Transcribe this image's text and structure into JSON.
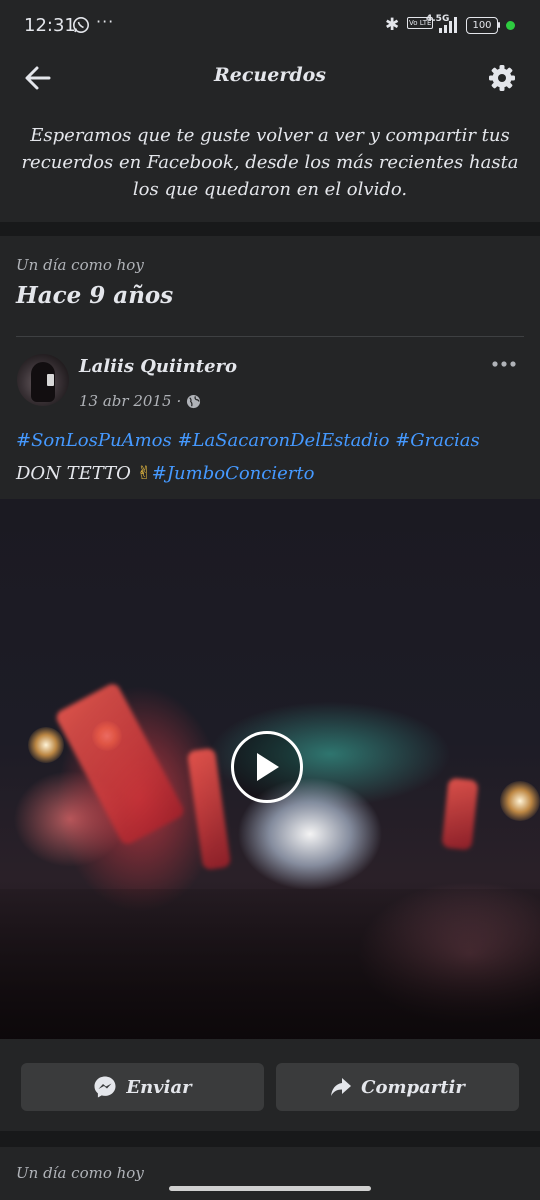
{
  "status_bar": {
    "time": "12:31",
    "more": "···",
    "volte": "Vo LTE",
    "network": "4.5G",
    "battery": "100"
  },
  "header": {
    "title": "Recuerdos",
    "intro": "Esperamos que te guste volver a ver y compartir tus recuerdos en Facebook, desde los más recientes hasta los que quedaron en el olvido."
  },
  "memory": {
    "subtitle": "Un día como hoy",
    "years_ago": "Hace 9 años",
    "post": {
      "author": "Laliis Quiintero",
      "date": "13 abr 2015",
      "date_separator": "·",
      "hashtags_line1": [
        "#SonLosPuAmos",
        "#LaSacaronDelEstadio",
        "#Gracias"
      ],
      "text_line2": "DON TETTO",
      "emoji": "✌",
      "hashtag_line2": "#JumboConcierto"
    },
    "actions": {
      "send": "Enviar",
      "share": "Compartir"
    }
  },
  "next_memory": {
    "subtitle": "Un día como hoy"
  },
  "icons": {
    "back": "arrow-left-icon",
    "settings": "gear-icon",
    "more": "more-horizontal-icon",
    "privacy": "globe-icon",
    "play": "play-icon",
    "send": "messenger-icon",
    "share": "share-arrow-icon"
  },
  "colors": {
    "background": "#18191a",
    "surface": "#242526",
    "button": "#3a3b3c",
    "hashtag": "#4599ff",
    "text": "#e4e6eb",
    "secondary_text": "#b0b3b8"
  }
}
